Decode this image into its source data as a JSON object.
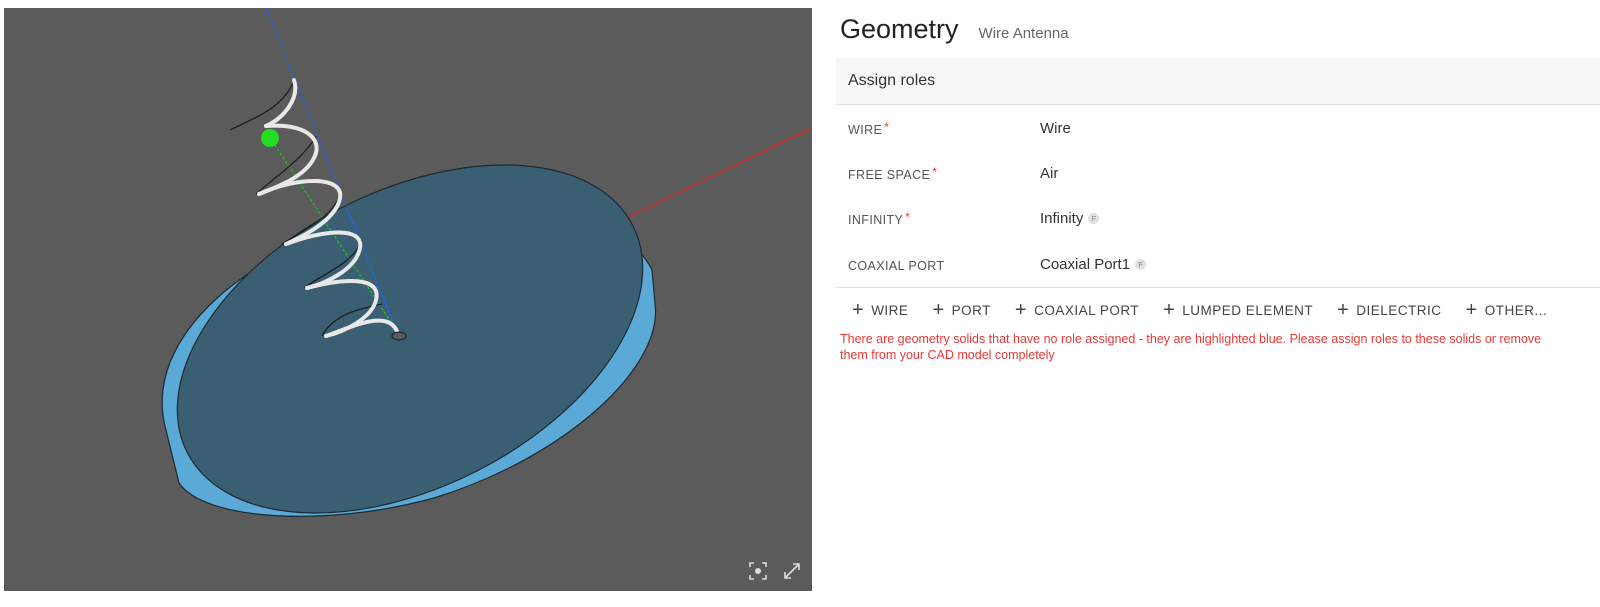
{
  "header": {
    "title": "Geometry",
    "subtitle": "Wire Antenna"
  },
  "section": {
    "title": "Assign roles"
  },
  "roles": [
    {
      "label": "WIRE",
      "required": "*",
      "value": "Wire",
      "badge": ""
    },
    {
      "label": "FREE SPACE",
      "required": "*",
      "value": "Air",
      "badge": ""
    },
    {
      "label": "INFINITY",
      "required": "*",
      "value": "Infinity",
      "badge": "F"
    },
    {
      "label": "COAXIAL PORT",
      "required": "",
      "value": "Coaxial Port1",
      "badge": "F"
    }
  ],
  "actions": [
    {
      "icon": "+",
      "label": "WIRE"
    },
    {
      "icon": "+",
      "label": "PORT"
    },
    {
      "icon": "+",
      "label": "COAXIAL PORT"
    },
    {
      "icon": "+",
      "label": "LUMPED ELEMENT"
    },
    {
      "icon": "+",
      "label": "DIELECTRIC"
    },
    {
      "icon": "+",
      "label": "OTHER..."
    }
  ],
  "warning": "There are geometry solids that have no role assigned - they are highlighted blue. Please assign roles to these solids or remove them from your CAD model completely",
  "viewport": {
    "background": "#5b5b5b",
    "disk_top_color": "#3a5f73",
    "disk_side_color": "#5aa9d6",
    "axis_colors": {
      "x": "#e02020",
      "y": "#20c020",
      "z": "#2060ff"
    },
    "toolbar_icons": [
      "focus-icon",
      "fullscreen-icon"
    ]
  },
  "colors": {
    "accent_required": "#e53935",
    "warning_text": "#e53935"
  }
}
